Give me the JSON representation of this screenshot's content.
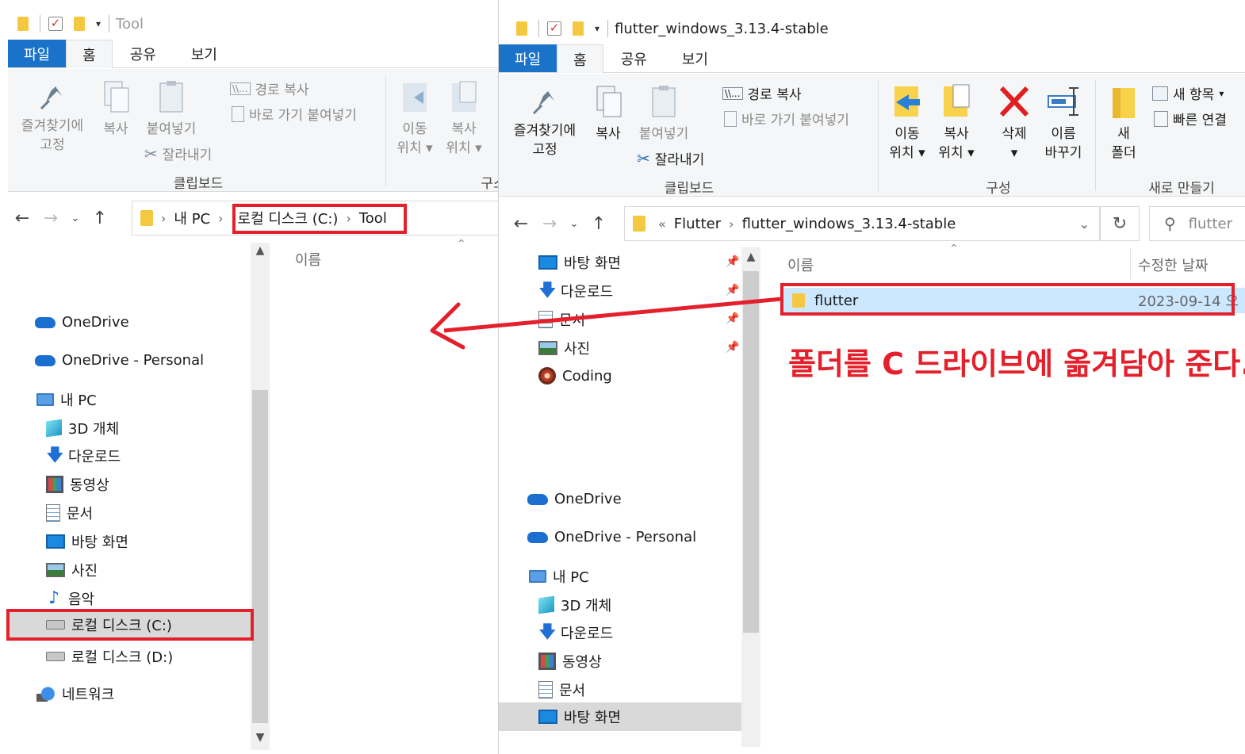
{
  "left_window": {
    "title": "Tool",
    "tabs": [
      "파일",
      "홈",
      "공유",
      "보기"
    ],
    "ribbon": {
      "pin_line1": "즐겨찾기에",
      "pin_line2": "고정",
      "copy": "복사",
      "paste": "붙여넣기",
      "copy_path": "경로 복사",
      "paste_shortcut": "바로 가기 붙여넣기",
      "cut": "잘라내기",
      "clipboard_group": "클립보드",
      "move_line1": "이동",
      "move_line2": "위치",
      "copyto_line1": "복사",
      "copyto_line2": "위치",
      "organize_partial": "구스"
    },
    "breadcrumb": [
      "내 PC",
      "로컬 디스크 (C:)",
      "Tool"
    ],
    "column_name": "이름",
    "nav": [
      {
        "label": "OneDrive"
      },
      {
        "label": "OneDrive - Personal"
      },
      {
        "label": "내 PC"
      },
      {
        "label": "3D 개체"
      },
      {
        "label": "다운로드"
      },
      {
        "label": "동영상"
      },
      {
        "label": "문서"
      },
      {
        "label": "바탕 화면"
      },
      {
        "label": "사진"
      },
      {
        "label": "음악"
      },
      {
        "label": "로컬 디스크 (C:)"
      },
      {
        "label": "로컬 디스크 (D:)"
      },
      {
        "label": "네트워크"
      }
    ]
  },
  "right_window": {
    "title": "flutter_windows_3.13.4-stable",
    "tabs": [
      "파일",
      "홈",
      "공유",
      "보기"
    ],
    "ribbon": {
      "pin_line1": "즐겨찾기에",
      "pin_line2": "고정",
      "copy": "복사",
      "paste": "붙여넣기",
      "copy_path": "경로 복사",
      "paste_shortcut": "바로 가기 붙여넣기",
      "cut": "잘라내기",
      "clipboard_group": "클립보드",
      "move_line1": "이동",
      "move_line2": "위치",
      "copyto_line1": "복사",
      "copyto_line2": "위치",
      "delete": "삭제",
      "rename_line1": "이름",
      "rename_line2": "바꾸기",
      "organize_group": "구성",
      "newfolder_line1": "새",
      "newfolder_line2": "폴더",
      "new_item": "새 항목",
      "easy_access": "빠른 연결",
      "new_group": "새로 만들기"
    },
    "breadcrumb_overflow": "«",
    "breadcrumb": [
      "Flutter",
      "flutter_windows_3.13.4-stable"
    ],
    "search_placeholder": "flutter",
    "column_name": "이름",
    "column_date": "수정한 날짜",
    "files": [
      {
        "name": "flutter",
        "date": "2023-09-14 오"
      }
    ],
    "quick_access": [
      {
        "label": "바탕 화면"
      },
      {
        "label": "다운로드"
      },
      {
        "label": "문서"
      },
      {
        "label": "사진"
      },
      {
        "label": "Coding"
      }
    ],
    "nav": [
      {
        "label": "OneDrive"
      },
      {
        "label": "OneDrive - Personal"
      },
      {
        "label": "내 PC"
      },
      {
        "label": "3D 개체"
      },
      {
        "label": "다운로드"
      },
      {
        "label": "동영상"
      },
      {
        "label": "문서"
      },
      {
        "label": "바탕 화면"
      }
    ]
  },
  "annotation": {
    "text": "폴더를 C 드라이브에 옮겨담아 준다.",
    "color": "#e3202b"
  },
  "colors": {
    "accent_file_tab": "#1a73c8",
    "selection": "#cce8ff",
    "annotation_red": "#e3202b"
  }
}
